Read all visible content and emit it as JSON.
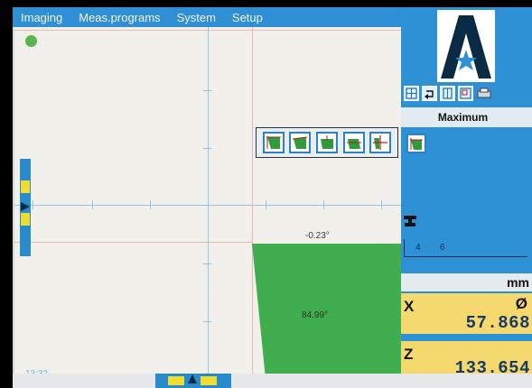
{
  "menu": {
    "items": [
      "Imaging",
      "Meas.programs",
      "System",
      "Setup"
    ]
  },
  "viewport": {
    "angle_top": "-0.23°",
    "angle_shape": "84.99°",
    "clock": "13:32"
  },
  "panel": {
    "tool_mode": "Maximum",
    "range_start": "4",
    "range_end": "6",
    "unit": "mm",
    "axes": [
      {
        "letter": "X",
        "mode": "Ø",
        "value": "57.868"
      },
      {
        "letter": "Z",
        "mode": "",
        "value": "133.654"
      }
    ]
  },
  "colors": {
    "menu_blue": "#2f8fd4",
    "shape_green": "#40ad4f",
    "axis_yellow": "#f6d96e"
  },
  "icons": {
    "logo": "logo-a-star-icon",
    "tools": [
      "edge-tool-icon",
      "edge-tool-icon",
      "edge-tool-icon",
      "edge-tool-icon",
      "crosshair-tool-icon"
    ]
  }
}
